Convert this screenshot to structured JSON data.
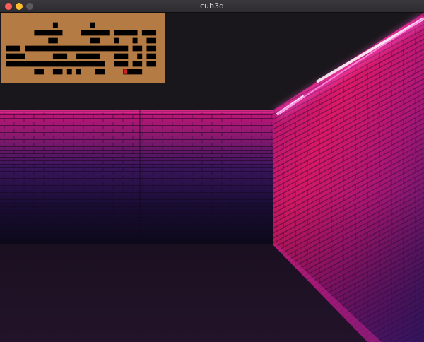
{
  "window": {
    "title": "cub3d",
    "controls": [
      "close",
      "minimize",
      "zoom"
    ]
  },
  "colors": {
    "ceiling": "#19171b",
    "floor": "#1f1226",
    "minimap_floor": "#b57b45",
    "minimap_wall": "#000000",
    "player": "#d01f25",
    "wall_top": "#c2187d",
    "wall_mid": "#6b1e8a",
    "wall_dark": "#1f0f3c",
    "right_wall_light": "#e8188a",
    "right_wall_dark": "#4a1c7a",
    "neon": "#ff5ad8"
  },
  "minimap": {
    "grid": [
      "00000000000000000000000000000000000",
      "00000000000100000001000000000000000",
      "00000001111110000111111011111011100",
      "00000000001100000001100010001001100",
      "01110111111111111111111111101101100",
      "01111000000111001111100011100101100",
      "01111111111111111111110011101101100",
      "00000001100110101000110000111100000",
      "00000000000000000000000000000000000"
    ],
    "player": {
      "row": 7,
      "col": 26
    }
  },
  "scene": {
    "description_free": true,
    "walls": [
      "far-wall",
      "right-wall"
    ],
    "neon_strip": true
  }
}
